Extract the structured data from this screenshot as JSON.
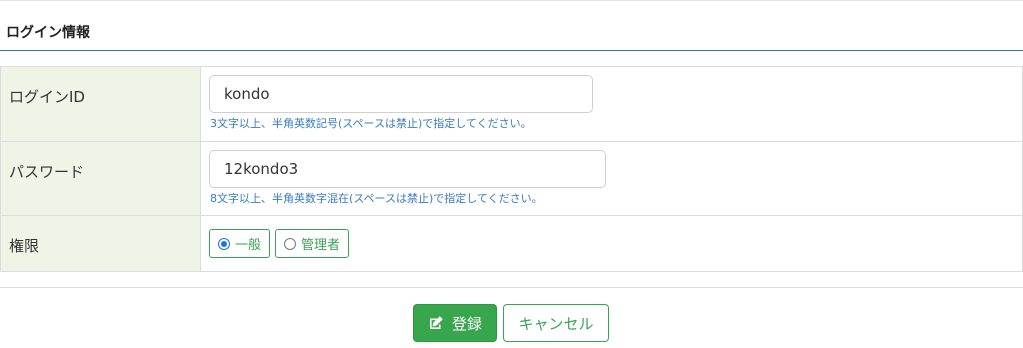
{
  "section": {
    "title": "ログイン情報"
  },
  "fields": {
    "login_id": {
      "label": "ログインID",
      "value": "kondo",
      "hint": "3文字以上、半角英数記号(スペースは禁止)で指定してください。"
    },
    "password": {
      "label": "パスワード",
      "value": "12kondo3",
      "hint": "8文字以上、半角英数字混在(スペースは禁止)で指定してください。"
    },
    "role": {
      "label": "権限",
      "options": [
        {
          "label": "一般",
          "checked": true
        },
        {
          "label": "管理者",
          "checked": false
        }
      ]
    }
  },
  "actions": {
    "submit_label": "登録",
    "cancel_label": "キャンセル"
  },
  "colors": {
    "accent_green": "#38a64c",
    "hint_blue": "#3a7cc4",
    "label_bg": "#eef4e6",
    "title_rule": "#2c6fb8"
  },
  "icons": {
    "submit": "edit-icon"
  }
}
